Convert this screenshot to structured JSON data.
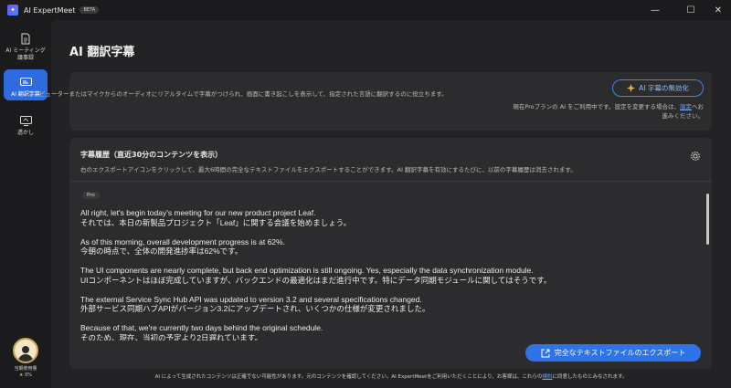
{
  "app": {
    "title": "AI ExpertMeet",
    "badge": "BETA"
  },
  "window_controls": {
    "minimize": "—",
    "maximize": "☐",
    "close": "✕"
  },
  "sidebar": {
    "items": [
      {
        "label": "AI ミーティング議事録"
      },
      {
        "label": "AI 翻訳字幕"
      },
      {
        "label": "透かし"
      }
    ],
    "usage_label": "当期使用量",
    "usage_value": "0%"
  },
  "page": {
    "title": "AI 翻訳字幕"
  },
  "intro": {
    "description": "コンピューターまたはマイクからのオーディオにリアルタイムで字幕がつけられ、画面に書き起こしを表示して、指定された言語に翻訳するのに役立ちます。",
    "disable_button": "AI 字幕の無効化",
    "plan_note_1": "現在Proプランの AI をご利用中です。設定を変更する場合は、",
    "plan_note_link": "設定",
    "plan_note_2": "へお進みください。"
  },
  "history": {
    "title": "字幕履歴（直近30分のコンテンツを表示）",
    "description": "右のエクスポートアイコンをクリックして、最大6時間の完全なテキストファイルをエクスポートすることができます。AI 翻訳字幕を有効にするたびに、以前の字幕履歴は消去されます。",
    "badge": "Pro",
    "entries": [
      {
        "en": "All right, let's begin today's meeting for our new product project Leaf.",
        "ja": "それでは、本日の新製品プロジェクト「Leaf」に関する会議を始めましょう。"
      },
      {
        "en": "As of this morning, overall development progress is at 62%.",
        "ja": "今朝の時点で、全体の開発進捗率は62%です。"
      },
      {
        "en": "The UI components are nearly complete, but back end optimization is still ongoing. Yes, especially the data synchronization module.",
        "ja": "UIコンポーネントはほぼ完成していますが、バックエンドの最適化はまだ進行中です。特にデータ同期モジュールに関してはそうです。"
      },
      {
        "en": "The external Service Sync Hub API was updated to version 3.2 and several specifications changed.",
        "ja": "外部サービス同期ハブAPIがバージョン3.2にアップデートされ、いくつかの仕様が変更されました。"
      },
      {
        "en": "Because of that, we're currently two days behind the original schedule.",
        "ja": "そのため、現在、当初の予定より2日遅れています。"
      }
    ],
    "export_button": "完全なテキストファイルのエクスポート"
  },
  "footer": {
    "text_1": "AI によって生成されたコンテンツは正確でない可能性があります。元のコンテンツを確認してください。AI ExpertMeetをご利用いただくことにより、お客様は、これらの",
    "link": "規約",
    "text_2": "に同意したものとみなされます。"
  },
  "colors": {
    "accent": "#2f73e8",
    "active_nav": "#2d6ce0",
    "background": "#1b1b1d",
    "panel": "#2c2c2e"
  },
  "icons": [
    "app-logo-icon",
    "document-icon",
    "subtitle-icon",
    "watermark-icon",
    "sparkle-icon",
    "gear-icon",
    "export-icon"
  ]
}
